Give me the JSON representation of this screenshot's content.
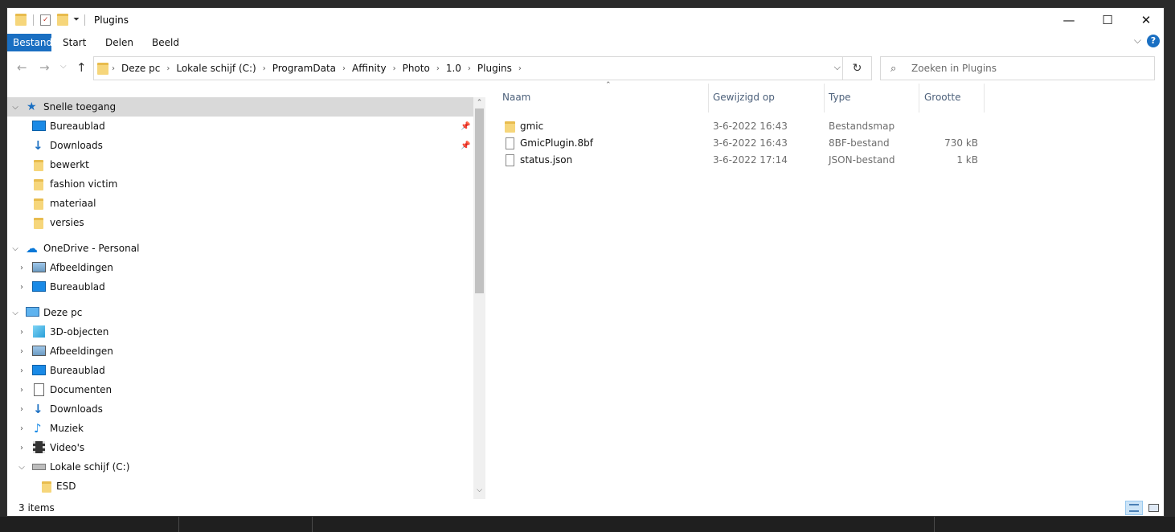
{
  "window": {
    "title": "Plugins"
  },
  "window_controls": {
    "minimize": "—",
    "maximize": "☐",
    "close": "✕"
  },
  "ribbon": {
    "tabs": [
      {
        "label": "Bestand",
        "active": true
      },
      {
        "label": "Start"
      },
      {
        "label": "Delen"
      },
      {
        "label": "Beeld"
      }
    ],
    "help": "?",
    "expand": "⌵"
  },
  "nav_buttons": {
    "back": "←",
    "forward": "→",
    "recent": "⌵",
    "up": "↑",
    "dropdown": "⌵",
    "refresh": "↻"
  },
  "address": {
    "breadcrumbs": [
      "Deze pc",
      "Lokale schijf (C:)",
      "ProgramData",
      "Affinity",
      "Photo",
      "1.0",
      "Plugins"
    ]
  },
  "search": {
    "placeholder": "Zoeken in Plugins",
    "value": ""
  },
  "nav_pane": {
    "items": [
      {
        "label": "Snelle toegang",
        "icon": "star-icon",
        "level": 0,
        "expanded": true,
        "selected": true
      },
      {
        "label": "Bureaublad",
        "icon": "desktop-icon",
        "level": 1,
        "pinned": true
      },
      {
        "label": "Downloads",
        "icon": "download-icon",
        "level": 1,
        "pinned": true
      },
      {
        "label": "bewerkt",
        "icon": "folder-icon",
        "level": 1
      },
      {
        "label": "fashion victim",
        "icon": "folder-icon",
        "level": 1
      },
      {
        "label": "materiaal",
        "icon": "folder-icon",
        "level": 1
      },
      {
        "label": "versies",
        "icon": "folder-icon",
        "level": 1
      },
      {
        "label": "OneDrive - Personal",
        "icon": "cloud-icon",
        "level": 0,
        "expanded": true
      },
      {
        "label": "Afbeeldingen",
        "icon": "pictures-icon",
        "level": 1,
        "collapsed": true
      },
      {
        "label": "Bureaublad",
        "icon": "desktop-icon",
        "level": 1,
        "collapsed": true
      },
      {
        "label": "Deze pc",
        "icon": "computer-icon",
        "level": 0,
        "expanded": true
      },
      {
        "label": "3D-objecten",
        "icon": "cube-icon",
        "level": 1,
        "collapsed": true
      },
      {
        "label": "Afbeeldingen",
        "icon": "pictures-icon",
        "level": 1,
        "collapsed": true
      },
      {
        "label": "Bureaublad",
        "icon": "desktop-icon",
        "level": 1,
        "collapsed": true
      },
      {
        "label": "Documenten",
        "icon": "document-icon",
        "level": 1,
        "collapsed": true
      },
      {
        "label": "Downloads",
        "icon": "download-icon",
        "level": 1,
        "collapsed": true
      },
      {
        "label": "Muziek",
        "icon": "music-icon",
        "level": 1,
        "collapsed": true
      },
      {
        "label": "Video's",
        "icon": "video-icon",
        "level": 1,
        "collapsed": true
      },
      {
        "label": "Lokale schijf (C:)",
        "icon": "drive-icon",
        "level": 1,
        "expanded": true
      },
      {
        "label": "ESD",
        "icon": "folder-icon",
        "level": 2
      }
    ]
  },
  "file_list": {
    "columns": [
      "Naam",
      "Gewijzigd op",
      "Type",
      "Grootte"
    ],
    "rows": [
      {
        "name": "gmic",
        "modified": "3-6-2022 16:43",
        "type": "Bestandsmap",
        "size": "",
        "icon": "folder-icon"
      },
      {
        "name": "GmicPlugin.8bf",
        "modified": "3-6-2022 16:43",
        "type": "8BF-bestand",
        "size": "730 kB",
        "icon": "file-icon"
      },
      {
        "name": "status.json",
        "modified": "3-6-2022 17:14",
        "type": "JSON-bestand",
        "size": "1 kB",
        "icon": "file-icon"
      }
    ]
  },
  "status_bar": {
    "item_count": "3 items"
  },
  "colors": {
    "accent": "#1a6fc2",
    "selection": "#d9d9d9",
    "folder": "#f6d67b",
    "header_text": "#4c607a"
  }
}
